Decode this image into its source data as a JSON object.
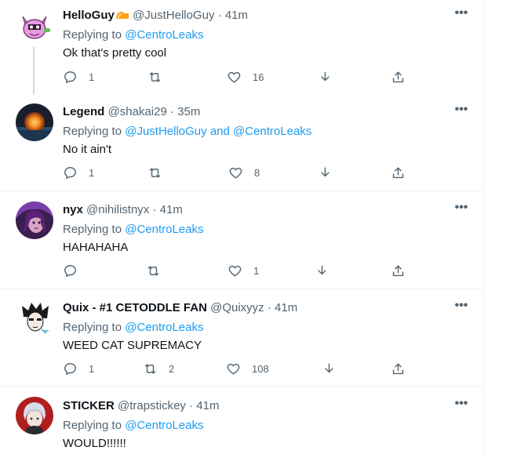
{
  "tweets": [
    {
      "name": "HelloGuy",
      "handle": "@JustHelloGuy",
      "time": "41m",
      "replying_label": "Replying to",
      "mentions": "@CentroLeaks",
      "text": "Ok that's pretty cool",
      "replies": "1",
      "retweets": "",
      "likes": "16",
      "has_badge": true,
      "avatar": "pink-monster-avatar"
    },
    {
      "name": "Legend",
      "handle": "@shakai29",
      "time": "35m",
      "replying_label": "Replying to",
      "mentions": "@JustHelloGuy and @CentroLeaks",
      "text": "No it ain't",
      "replies": "1",
      "retweets": "",
      "likes": "8",
      "avatar": "sunset-planet-avatar"
    },
    {
      "name": "nyx",
      "handle": "@nihilistnyx",
      "time": "41m",
      "replying_label": "Replying to",
      "mentions": "@CentroLeaks",
      "text": "HAHAHAHA",
      "replies": "",
      "retweets": "",
      "likes": "1",
      "avatar": "purple-character-avatar"
    },
    {
      "name": "Quix - #1 CETODDLE FAN",
      "handle": "@Quixyyz",
      "time": "41m",
      "replying_label": "Replying to",
      "mentions": "@CentroLeaks",
      "text": "WEED CAT SUPREMACY",
      "replies": "1",
      "retweets": "2",
      "likes": "108",
      "avatar": "anime-boy-avatar"
    },
    {
      "name": "STICKER",
      "handle": "@trapstickey",
      "time": "41m",
      "replying_label": "Replying to",
      "mentions": "@CentroLeaks",
      "text": "WOULD!!!!!!",
      "avatar": "silver-hair-avatar"
    }
  ],
  "separator": "·",
  "more_glyph": "•••",
  "colors": {
    "accent": "#1d9bf0",
    "secondary_text": "#536471",
    "border": "#eff3f4"
  },
  "icons": [
    "reply-icon",
    "retweet-icon",
    "like-icon",
    "download-icon",
    "share-icon",
    "more-icon"
  ]
}
